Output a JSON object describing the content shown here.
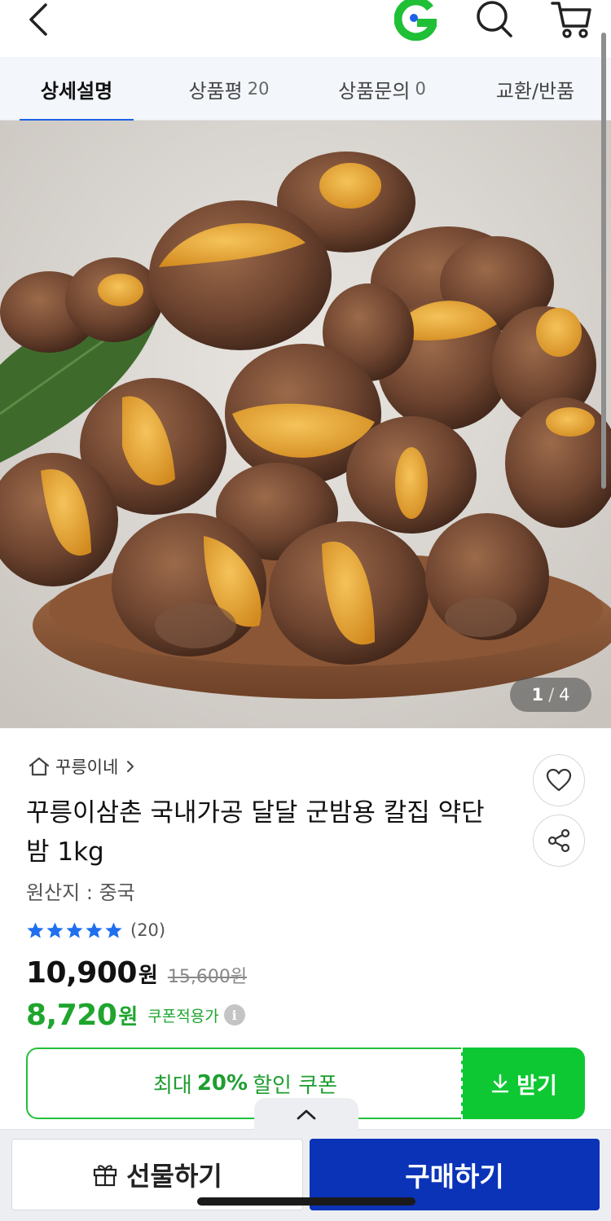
{
  "header": {
    "icons": [
      "back-arrow-icon",
      "g-logo",
      "search-icon",
      "cart-icon"
    ],
    "brand_color": "#1fbf36"
  },
  "tabs": [
    {
      "label": "상세설명",
      "count": "",
      "active": true
    },
    {
      "label": "상품평",
      "count": "20",
      "active": false
    },
    {
      "label": "상품문의",
      "count": "0",
      "active": false
    },
    {
      "label": "교환/반품",
      "count": "",
      "active": false
    }
  ],
  "gallery": {
    "current": "1",
    "separator": "/",
    "total": "4"
  },
  "product": {
    "store": "꾸릉이네",
    "title": "꾸릉이삼촌 국내가공 달달 군밤용 칼집 약단밤 1kg",
    "origin": "원산지 : 중국",
    "rating_stars": 5,
    "rating_count": "(20)",
    "price": "10,900",
    "price_unit": "원",
    "original_price": "15,600원",
    "coupon_price": "8,720",
    "coupon_unit": "원",
    "coupon_label": "쿠폰적용가",
    "info_symbol": "i"
  },
  "coupon": {
    "prefix": "최대",
    "percent": "20%",
    "suffix": "할인 쿠폰",
    "download_label": "받기",
    "accent": "#0ec833"
  },
  "bottom_bar": {
    "gift_label": "선물하기",
    "buy_label": "구매하기",
    "buy_color": "#0a33b8"
  }
}
